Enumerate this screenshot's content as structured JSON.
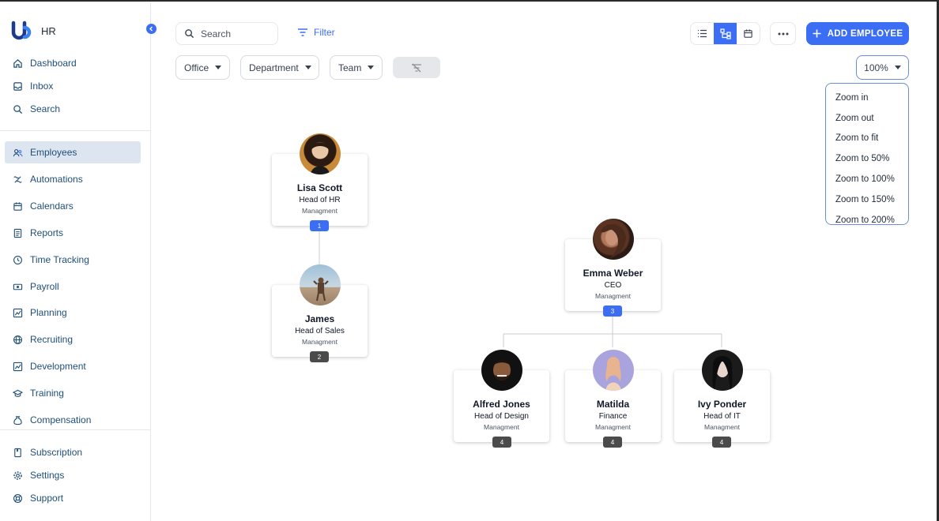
{
  "app": {
    "name": "HR"
  },
  "nav_top": [
    {
      "label": "Dashboard",
      "icon": "home-icon"
    },
    {
      "label": "Inbox",
      "icon": "inbox-icon"
    },
    {
      "label": "Search",
      "icon": "search-icon"
    }
  ],
  "nav_main": [
    {
      "label": "Employees",
      "icon": "users-icon",
      "active": true
    },
    {
      "label": "Automations",
      "icon": "automation-icon"
    },
    {
      "label": "Calendars",
      "icon": "calendar-icon"
    },
    {
      "label": "Reports",
      "icon": "report-icon"
    },
    {
      "label": "Time Tracking",
      "icon": "clock-icon"
    },
    {
      "label": "Payroll",
      "icon": "payroll-icon"
    },
    {
      "label": "Planning",
      "icon": "chart-icon"
    },
    {
      "label": "Recruiting",
      "icon": "globe-icon"
    },
    {
      "label": "Development",
      "icon": "chart-icon"
    },
    {
      "label": "Training",
      "icon": "graduation-icon"
    },
    {
      "label": "Compensation",
      "icon": "money-bag-icon"
    }
  ],
  "nav_bottom": [
    {
      "label": "Subscription",
      "icon": "bookmark-icon"
    },
    {
      "label": "Settings",
      "icon": "gear-icon"
    },
    {
      "label": "Support",
      "icon": "lifebuoy-icon"
    }
  ],
  "toolbar": {
    "search_placeholder": "Search",
    "filter_label": "Filter",
    "add_employee_label": "ADD EMPLOYEE",
    "active_view": "org-chart"
  },
  "filters": {
    "office": "Office",
    "department": "Department",
    "team": "Team"
  },
  "zoom": {
    "current": "100%",
    "options": [
      "Zoom in",
      "Zoom out",
      "Zoom to fit",
      "Zoom to 50%",
      "Zoom to 100%",
      "Zoom to 150%",
      "Zoom to 200%"
    ]
  },
  "org": {
    "lisa": {
      "name": "Lisa Scott",
      "role": "Head of HR",
      "dept": "Managment",
      "count": "1"
    },
    "james": {
      "name": "James",
      "role": "Head of Sales",
      "dept": "Managment",
      "count": "2"
    },
    "emma": {
      "name": "Emma Weber",
      "role": "CEO",
      "dept": "Managment",
      "count": "3"
    },
    "alfred": {
      "name": "Alfred Jones",
      "role": "Head of Design",
      "dept": "Managment",
      "count": "4"
    },
    "matilda": {
      "name": "Matilda",
      "role": "Finance",
      "dept": "Managment",
      "count": "4"
    },
    "ivy": {
      "name": "Ivy Ponder",
      "role": "Head of IT",
      "dept": "Managment",
      "count": "4"
    }
  },
  "colors": {
    "accent": "#3b6ef5",
    "nav_text": "#1f4e79",
    "active_bg": "#dde6f0",
    "badge_dark": "#4b4b4b"
  }
}
